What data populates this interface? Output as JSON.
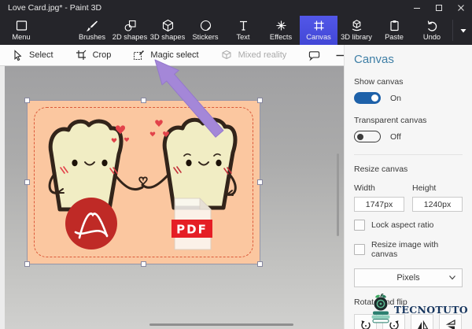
{
  "window": {
    "title": "Love Card.jpg* - Paint 3D"
  },
  "ribbon": {
    "items": [
      {
        "label": "Menu"
      },
      {
        "label": "Brushes"
      },
      {
        "label": "2D shapes"
      },
      {
        "label": "3D shapes"
      },
      {
        "label": "Stickers"
      },
      {
        "label": "Text"
      },
      {
        "label": "Effects"
      },
      {
        "label": "Canvas",
        "active": true
      },
      {
        "label": "3D library"
      }
    ],
    "paste_label": "Paste",
    "undo_label": "Undo"
  },
  "subtoolbar": {
    "select_label": "Select",
    "crop_label": "Crop",
    "magic_select_label": "Magic select",
    "mixed_reality_label": "Mixed reality"
  },
  "panel": {
    "title": "Canvas",
    "show_canvas_label": "Show canvas",
    "show_canvas_state": "On",
    "transparent_canvas_label": "Transparent canvas",
    "transparent_canvas_state": "Off",
    "resize_canvas_label": "Resize canvas",
    "width_label": "Width",
    "width_value": "1747px",
    "height_label": "Height",
    "height_value": "1240px",
    "lock_aspect_label": "Lock aspect ratio",
    "resize_with_canvas_label": "Resize image with canvas",
    "units_value": "Pixels",
    "rotate_flip_label": "Rotate and flip"
  },
  "canvas_image": {
    "pdf_label": "PDF"
  },
  "watermark": {
    "text": "TECNOTUTO"
  },
  "icons": {
    "ribbon": [
      "menu",
      "brushes",
      "2d-shapes",
      "3d-shapes",
      "stickers",
      "text",
      "effects",
      "canvas",
      "3d-library",
      "paste",
      "undo",
      "dropdown-caret",
      "chevron-up"
    ],
    "subtoolbar": [
      "select-cursor",
      "crop",
      "magic-select",
      "mixed-reality",
      "speech-bubble",
      "zoom-out-minus",
      "zoom-in-plus",
      "ellipsis"
    ],
    "rotate_flip": [
      "rotate-left",
      "rotate-right",
      "flip-horizontal",
      "flip-vertical"
    ]
  },
  "colors": {
    "accent_tab": "#4b4fe1",
    "toggle_on": "#1e61a9",
    "panel_title": "#3f7fa6",
    "annotation_arrow": "#a487d8",
    "card_background": "#fbc7a0",
    "pdf_red": "#e51e25",
    "adobe_red": "#bf2a26"
  }
}
